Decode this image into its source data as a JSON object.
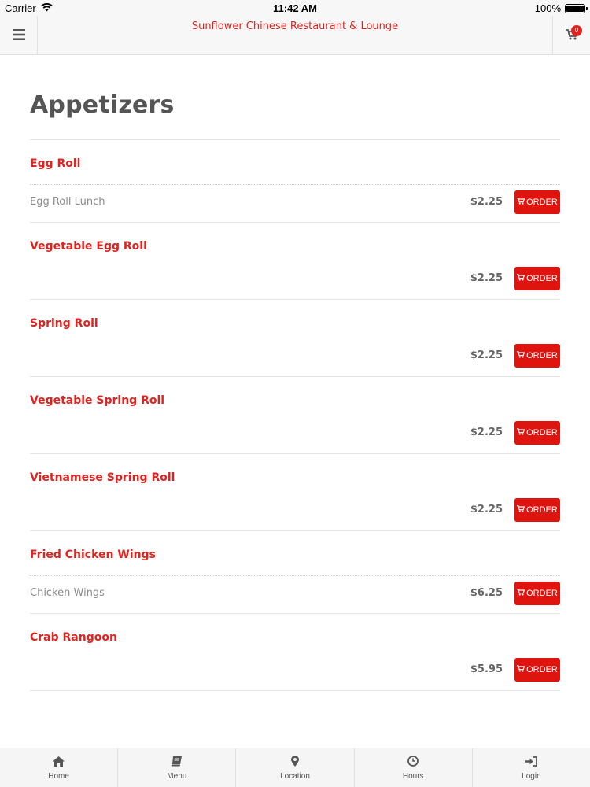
{
  "status_bar": {
    "carrier": "Carrier",
    "time": "11:42 AM",
    "battery": "100%",
    "battery_level": 1.0
  },
  "nav": {
    "title": "Sunflower Chinese Restaurant & Lounge",
    "cart_count": "0",
    "menu_icon": "hamburger-icon",
    "cart_icon": "cart-icon"
  },
  "section": {
    "title": "Appetizers"
  },
  "order_label": "ORDER",
  "items": [
    {
      "name": "Egg Roll",
      "variant": "Egg Roll Lunch",
      "price": "$2.25"
    },
    {
      "name": "Vegetable Egg Roll",
      "variant": "",
      "price": "$2.25"
    },
    {
      "name": "Spring Roll",
      "variant": "",
      "price": "$2.25"
    },
    {
      "name": "Vegetable Spring Roll",
      "variant": "",
      "price": "$2.25"
    },
    {
      "name": "Vietnamese Spring Roll",
      "variant": "",
      "price": "$2.25"
    },
    {
      "name": "Fried Chicken Wings",
      "variant": "Chicken Wings",
      "price": "$6.25"
    },
    {
      "name": "Crab Rangoon",
      "variant": "",
      "price": "$5.95"
    }
  ],
  "tabs": [
    {
      "label": "Home",
      "icon": "home-icon"
    },
    {
      "label": "Menu",
      "icon": "book-icon"
    },
    {
      "label": "Location",
      "icon": "map-pin-icon"
    },
    {
      "label": "Hours",
      "icon": "clock-icon"
    },
    {
      "label": "Login",
      "icon": "sign-in-icon"
    }
  ],
  "colors": {
    "accent": "#e0231f",
    "button": "#e0140f",
    "heading": "#555555"
  }
}
